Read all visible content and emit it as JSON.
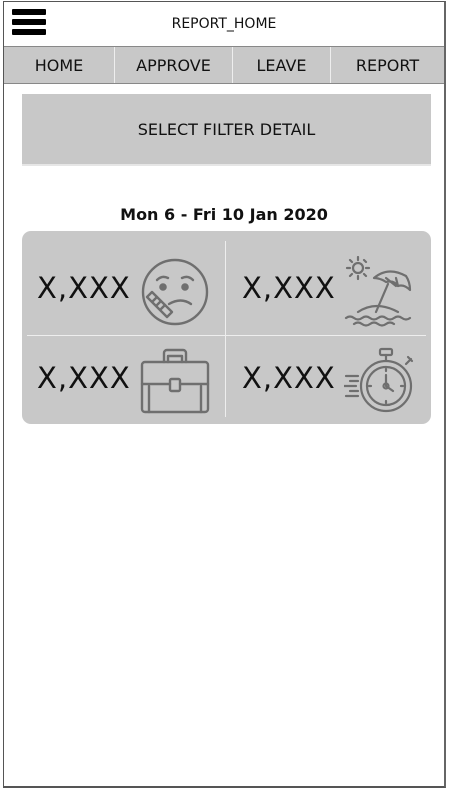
{
  "header": {
    "title": "REPORT_HOME",
    "menu_icon": "hamburger-menu-icon"
  },
  "nav": {
    "tabs": [
      {
        "label": "HOME"
      },
      {
        "label": "APPROVE"
      },
      {
        "label": "LEAVE"
      },
      {
        "label": "REPORT"
      }
    ]
  },
  "filter": {
    "label": "SELECT FILTER DETAIL"
  },
  "summary": {
    "date_range": "Mon 6 - Fri 10 Jan 2020",
    "stats": [
      {
        "value": "X,XXX",
        "icon": "sick-face-icon"
      },
      {
        "value": "X,XXX",
        "icon": "beach-umbrella-icon"
      },
      {
        "value": "X,XXX",
        "icon": "briefcase-icon"
      },
      {
        "value": "X,XXX",
        "icon": "stopwatch-icon"
      }
    ]
  },
  "colors": {
    "panel": "#c8c8c8",
    "icon_stroke": "#6f6f6f",
    "text": "#111111"
  }
}
